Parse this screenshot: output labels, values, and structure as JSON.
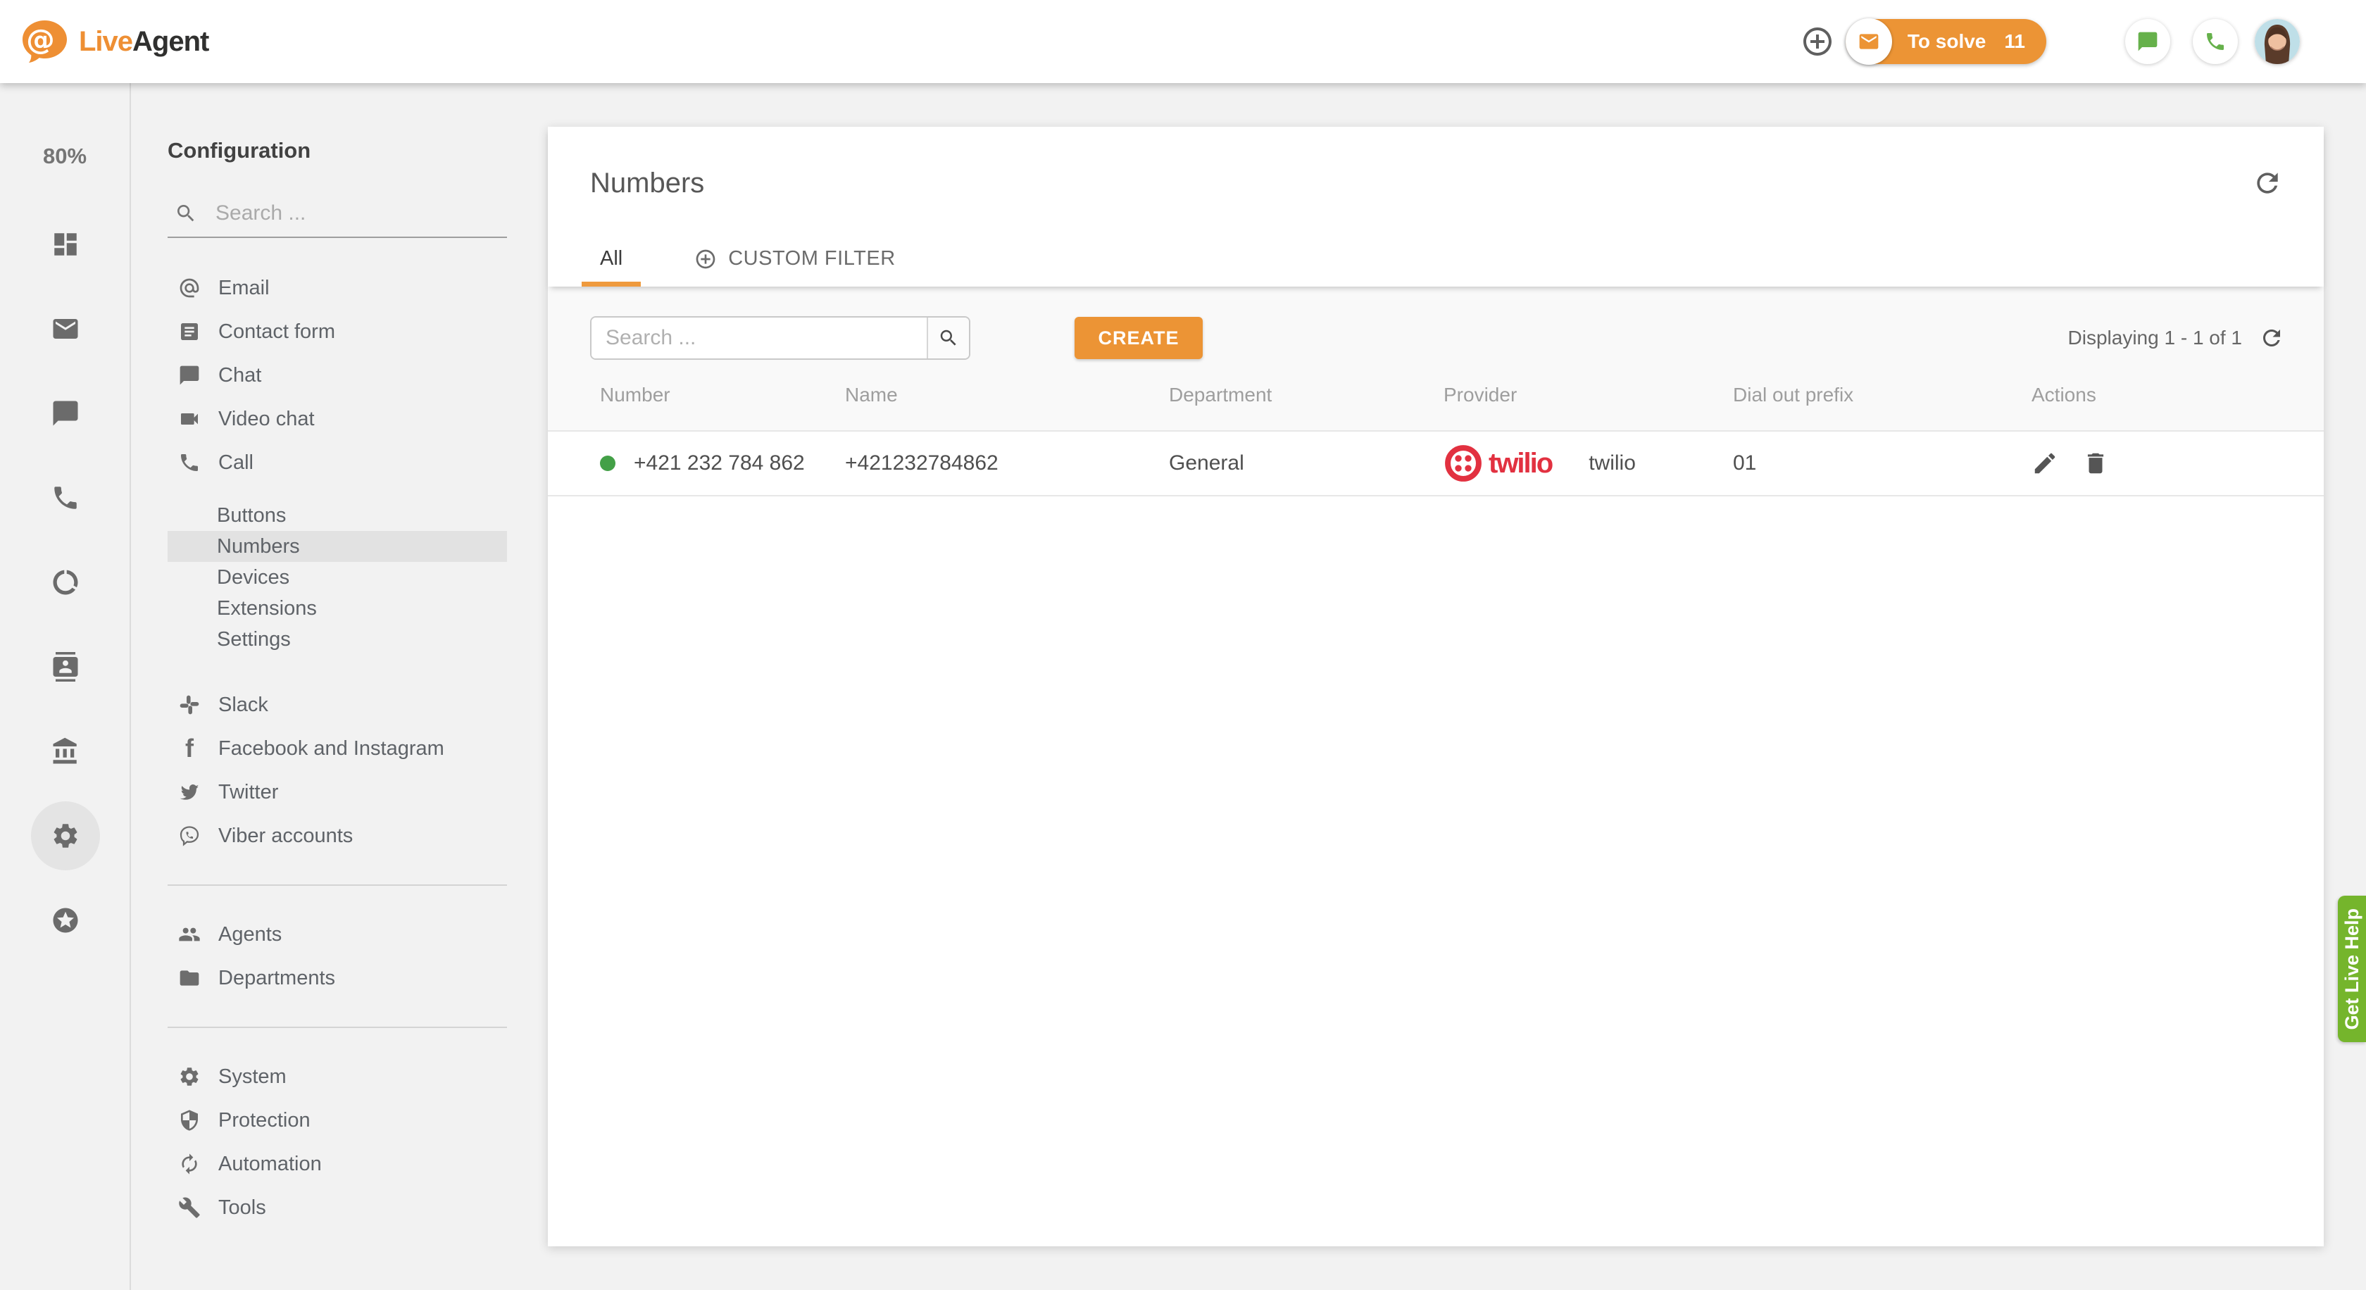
{
  "brand": {
    "name_part1": "Live",
    "name_part2": "Agent"
  },
  "topbar": {
    "to_solve_label": "To solve",
    "to_solve_count": "11"
  },
  "rail": {
    "usage": "80%",
    "icons": [
      "dashboard",
      "mail",
      "chat",
      "call",
      "data-usage",
      "contacts",
      "bank",
      "settings",
      "stars"
    ],
    "active_icon": "settings"
  },
  "sidebar": {
    "title": "Configuration",
    "search_placeholder": "Search ...",
    "items": [
      {
        "label": "Email",
        "icon": "email"
      },
      {
        "label": "Contact form",
        "icon": "contact-form"
      },
      {
        "label": "Chat",
        "icon": "chat"
      },
      {
        "label": "Video chat",
        "icon": "video-chat"
      },
      {
        "label": "Call",
        "icon": "call"
      },
      {
        "label": "Buttons",
        "type": "sub"
      },
      {
        "label": "Numbers",
        "type": "sub",
        "selected": true
      },
      {
        "label": "Devices",
        "type": "sub"
      },
      {
        "label": "Extensions",
        "type": "sub"
      },
      {
        "label": "Settings",
        "type": "sub"
      },
      {
        "label": "Slack",
        "icon": "slack"
      },
      {
        "label": "Facebook and Instagram",
        "icon": "facebook"
      },
      {
        "label": "Twitter",
        "icon": "twitter"
      },
      {
        "label": "Viber accounts",
        "icon": "viber"
      },
      {
        "label": "Agents",
        "icon": "agents"
      },
      {
        "label": "Departments",
        "icon": "departments"
      },
      {
        "label": "System",
        "icon": "system"
      },
      {
        "label": "Protection",
        "icon": "protection"
      },
      {
        "label": "Automation",
        "icon": "automation"
      },
      {
        "label": "Tools",
        "icon": "tools"
      }
    ]
  },
  "main": {
    "title": "Numbers",
    "tabs": {
      "all": "All",
      "custom_filter": "CUSTOM FILTER"
    },
    "toolbar": {
      "search_placeholder": "Search ...",
      "create_label": "CREATE",
      "displaying": "Displaying 1 - 1 of 1"
    },
    "table": {
      "columns": [
        "Number",
        "Name",
        "Department",
        "Provider",
        "Dial out prefix",
        "Actions"
      ],
      "rows": [
        {
          "status": "active",
          "number": "+421 232 784 862",
          "name": "+421232784862",
          "department": "General",
          "provider": "twilio",
          "dial_out_prefix": "01"
        }
      ]
    }
  },
  "help_tab": {
    "label": "Get Live Help"
  },
  "colors": {
    "accent_orange": "#ec9435",
    "brand_orange": "#ee8f34",
    "icon_green": "#66b14b",
    "help_green": "#75b52c",
    "twilio_red": "#e23140",
    "status_green": "#43a047",
    "selected_item_bg": "#e2e2e2"
  }
}
